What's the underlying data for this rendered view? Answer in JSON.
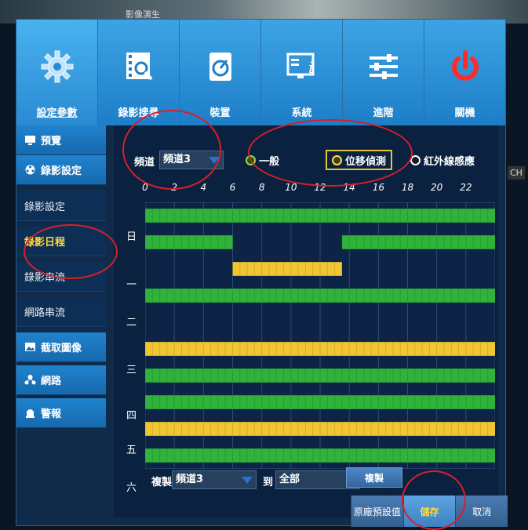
{
  "background": {
    "partial_label": "影像演生",
    "right_tag": "CH"
  },
  "topbar": {
    "items": [
      {
        "label": "設定參數",
        "icon": "gear-icon",
        "active": true
      },
      {
        "label": "錄影搜尋",
        "icon": "film-search-icon"
      },
      {
        "label": "裝置",
        "icon": "disk-icon"
      },
      {
        "label": "系統",
        "icon": "system-info-icon"
      },
      {
        "label": "進階",
        "icon": "sliders-icon"
      },
      {
        "label": "關機",
        "icon": "power-icon"
      }
    ]
  },
  "sidebar": {
    "items": [
      {
        "label": "預覽",
        "kind": "top",
        "icon": "monitor-icon"
      },
      {
        "label": "錄影設定",
        "kind": "top",
        "icon": "film-reel-icon"
      },
      {
        "label": "錄影設定",
        "kind": "sub"
      },
      {
        "label": "錄影日程",
        "kind": "sub",
        "selected": true
      },
      {
        "label": "錄影串流",
        "kind": "sub"
      },
      {
        "label": "網路串流",
        "kind": "sub"
      },
      {
        "label": "截取圖像",
        "kind": "top",
        "icon": "image-icon"
      },
      {
        "label": "網路",
        "kind": "top",
        "icon": "network-icon"
      },
      {
        "label": "警報",
        "kind": "top",
        "icon": "alarm-icon"
      }
    ]
  },
  "schedule": {
    "channel_label": "頻道",
    "channel_value": "頻道3",
    "modes": [
      {
        "label": "一般",
        "color": "#3bb63b"
      },
      {
        "label": "位移偵測",
        "color": "#f0c93c",
        "selected": true
      },
      {
        "label": "紅外線感應",
        "color": "#ffffff"
      }
    ],
    "hour_labels": [
      "0",
      "2",
      "4",
      "6",
      "8",
      "10",
      "12",
      "14",
      "16",
      "18",
      "20",
      "22"
    ],
    "day_labels": [
      "日",
      "一",
      "二",
      "三",
      "四",
      "五",
      "六"
    ],
    "rows": [
      [
        {
          "start": 0,
          "end": 24,
          "mode": "normal"
        }
      ],
      [
        {
          "start": 0,
          "end": 6,
          "mode": "normal"
        },
        {
          "start": 13.5,
          "end": 24,
          "mode": "normal"
        }
      ],
      [
        {
          "start": 6,
          "end": 13.5,
          "mode": "motion"
        }
      ],
      [
        {
          "start": 0,
          "end": 24,
          "mode": "normal"
        }
      ],
      [],
      [
        {
          "start": 0,
          "end": 24,
          "mode": "motion"
        }
      ],
      [
        {
          "start": 0,
          "end": 24,
          "mode": "normal"
        }
      ],
      [
        {
          "start": 0,
          "end": 24,
          "mode": "normal"
        }
      ],
      [
        {
          "start": 0,
          "end": 24,
          "mode": "motion"
        }
      ],
      [
        {
          "start": 0,
          "end": 24,
          "mode": "normal"
        }
      ]
    ],
    "colors": {
      "normal": "#2fb33a",
      "motion": "#f2c631"
    }
  },
  "copy": {
    "copy_label": "複製",
    "from_value": "頻道3",
    "to_label": "到",
    "to_value": "全部",
    "copy_button": "複製"
  },
  "footer": {
    "default_button": "原廠預設值",
    "save_button": "儲存",
    "cancel_button": "取消"
  }
}
